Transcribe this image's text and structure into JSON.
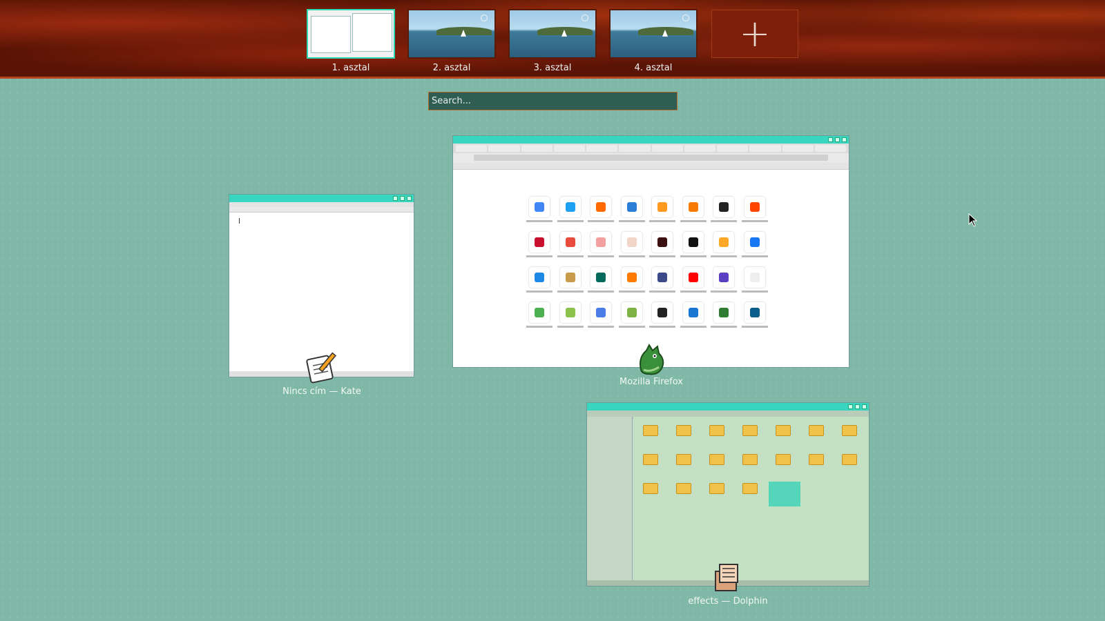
{
  "desktops": [
    {
      "label": "1. asztal",
      "active": true
    },
    {
      "label": "2. asztal",
      "active": false
    },
    {
      "label": "3. asztal",
      "active": false
    },
    {
      "label": "4. asztal",
      "active": false
    }
  ],
  "add_desktop": {
    "label": "+"
  },
  "search": {
    "placeholder": "Search..."
  },
  "windows": {
    "kate": {
      "caption": "Nincs cím — Kate",
      "icon": "text-editor-icon"
    },
    "firefox": {
      "caption": "Mozilla Firefox",
      "icon": "firefox-icon"
    },
    "dolphin": {
      "caption": "effects — Dolphin",
      "icon": "file-manager-icon"
    }
  },
  "colors": {
    "background": "#7fb8a6",
    "active_desktop_border": "#2fd8b4",
    "bar_background": "#5a1405"
  }
}
